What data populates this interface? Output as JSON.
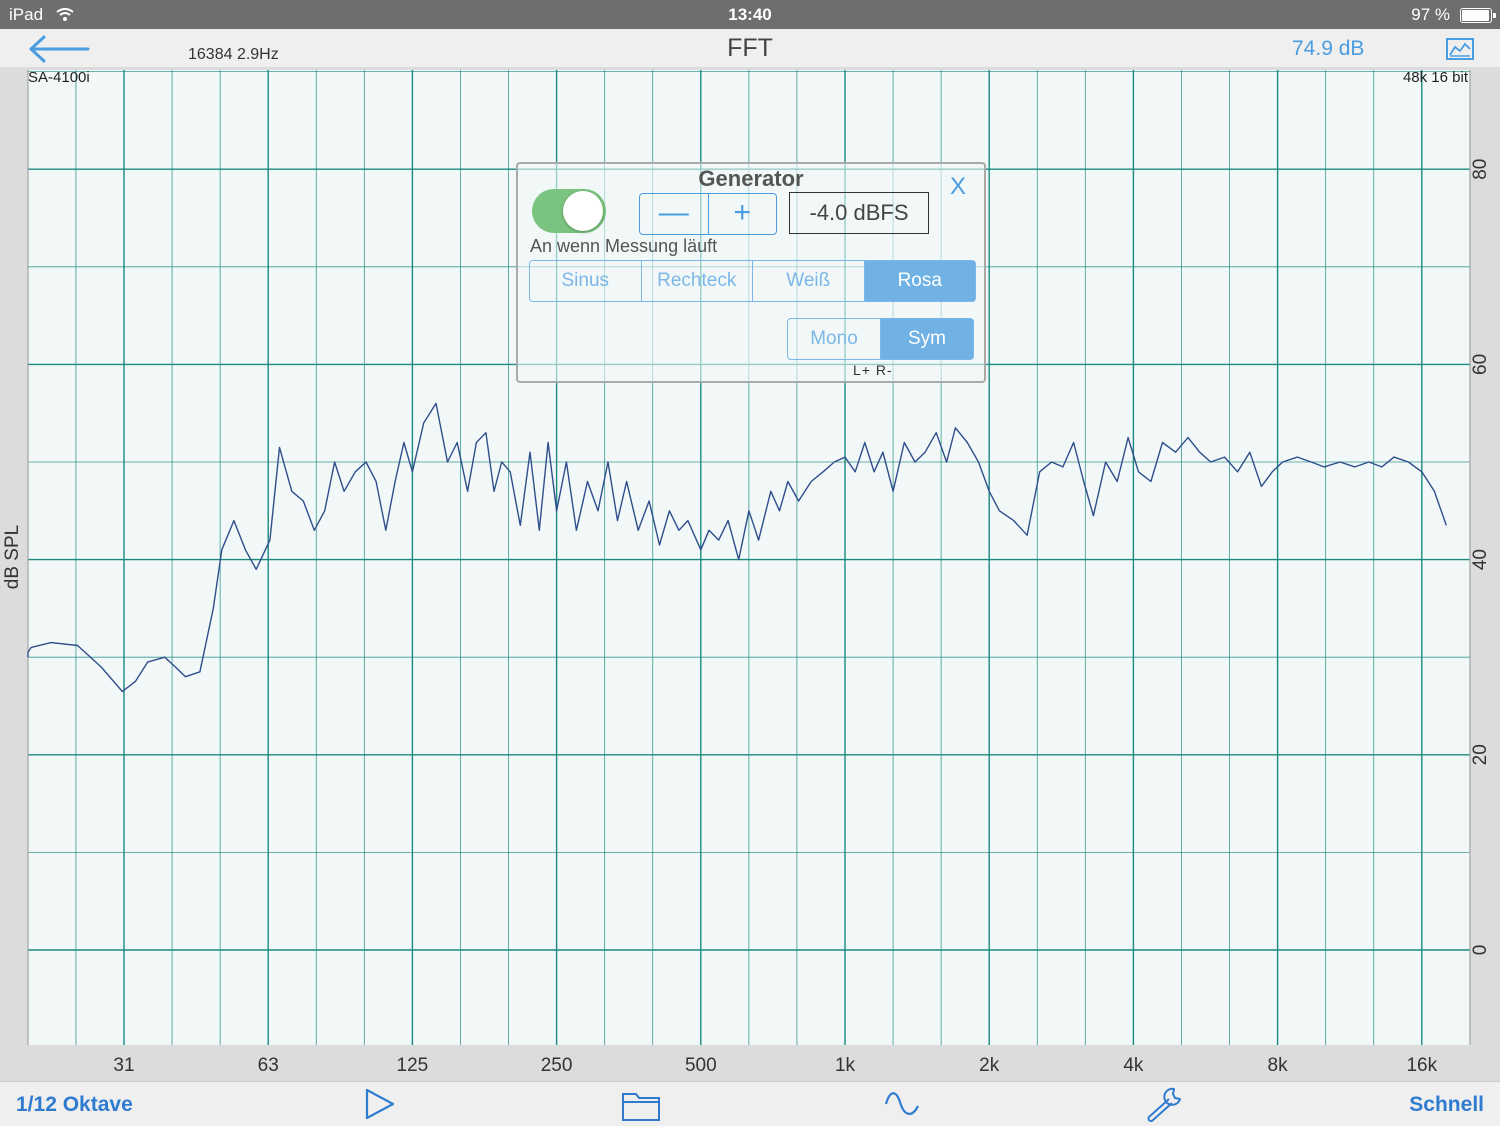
{
  "status": {
    "device": "iPad",
    "time": "13:40",
    "battery": "97 %"
  },
  "nav": {
    "title": "FFT",
    "fft_info": "16384  2.9Hz",
    "level": "74.9 dB"
  },
  "plot": {
    "device_label": "SA-4100i",
    "rate_label": "48k 16 bit",
    "ylabel": "dB SPL",
    "grid_color": "#1a8a80",
    "line_color": "#2f4e8c",
    "background": "#f2f8f7"
  },
  "chart_data": {
    "type": "line",
    "xscale": "log",
    "xlim": [
      16,
      22000
    ],
    "ylim": [
      -10,
      90
    ],
    "x_ticks": [
      "31",
      "63",
      "125",
      "250",
      "500",
      "1k",
      "2k",
      "4k",
      "8k",
      "16k"
    ],
    "y_ticks": [
      "0",
      "20",
      "40",
      "60",
      "80"
    ],
    "ylabel": "dB SPL",
    "x": [
      16,
      18,
      20,
      22,
      25,
      28,
      31,
      33,
      35,
      38,
      40,
      42,
      45,
      48,
      50,
      53,
      56,
      59,
      63,
      66,
      70,
      74,
      78,
      82,
      86,
      90,
      95,
      100,
      105,
      110,
      115,
      120,
      125,
      132,
      140,
      148,
      155,
      163,
      170,
      178,
      185,
      192,
      200,
      210,
      220,
      230,
      240,
      250,
      262,
      275,
      290,
      305,
      320,
      335,
      350,
      370,
      390,
      410,
      430,
      450,
      470,
      500,
      520,
      545,
      570,
      600,
      630,
      660,
      700,
      730,
      760,
      800,
      850,
      900,
      950,
      1000,
      1050,
      1100,
      1150,
      1200,
      1260,
      1330,
      1400,
      1470,
      1550,
      1630,
      1700,
      1800,
      1900,
      2000,
      2100,
      2250,
      2400,
      2550,
      2700,
      2850,
      3000,
      3150,
      3300,
      3500,
      3700,
      3900,
      4100,
      4350,
      4600,
      4900,
      5200,
      5500,
      5800,
      6200,
      6600,
      7000,
      7400,
      7800,
      8200,
      8800,
      9400,
      10000,
      10800,
      11600,
      12400,
      13200,
      14000,
      15000,
      16000,
      17000,
      18000,
      19000,
      20000
    ],
    "series": [
      {
        "values": [
          30,
          30.5,
          31,
          31.5,
          31.2,
          29,
          26.5,
          27.5,
          29.5,
          30,
          29,
          28,
          28.5,
          35,
          41,
          44,
          41,
          39,
          42,
          51.5,
          47,
          46,
          43,
          45,
          50,
          47,
          49,
          50,
          48,
          43,
          48,
          52,
          49,
          54,
          56,
          50,
          52,
          47,
          52,
          53,
          47,
          50,
          49,
          43.5,
          51,
          43,
          52,
          45,
          50,
          43,
          48,
          45,
          50,
          44,
          48,
          43,
          46,
          41.5,
          45,
          43,
          44,
          41,
          43,
          42,
          44,
          40,
          45,
          42,
          47,
          45,
          48,
          46,
          48,
          49,
          50,
          50.5,
          49,
          52,
          49,
          51,
          47,
          52,
          50,
          51,
          53,
          50,
          53.5,
          52,
          50,
          47,
          45,
          44,
          42.5,
          49,
          50,
          49.5,
          52,
          48,
          44.5,
          50,
          48,
          52.5,
          49,
          48,
          52,
          51,
          52.5,
          51,
          50,
          50.5,
          49,
          51,
          47.5,
          49,
          50,
          50.5,
          50,
          49.5,
          50,
          49.5,
          50,
          49.5,
          50.5,
          50,
          49,
          47,
          43.5
        ]
      }
    ]
  },
  "generator": {
    "title": "Generator",
    "close": "X",
    "toggle_label": "An wenn Messung läuft",
    "toggle_on": true,
    "minus": "—",
    "plus": "+",
    "level": "-4.0 dBFS",
    "waveforms": [
      "Sinus",
      "Rechteck",
      "Weiß",
      "Rosa"
    ],
    "selected_waveform": "Rosa",
    "modes": [
      "Mono",
      "Sym"
    ],
    "selected_mode": "Sym",
    "lr_label": "L+  R-"
  },
  "toolbar": {
    "resolution": "1/12 Oktave",
    "speed": "Schnell",
    "icons": [
      "play-icon",
      "folder-icon",
      "waveform-icon",
      "wrench-icon"
    ]
  },
  "colors": {
    "accent": "#4a9de0",
    "toggle_green": "#7bc47f",
    "selected_segment": "#6fb2e3"
  }
}
